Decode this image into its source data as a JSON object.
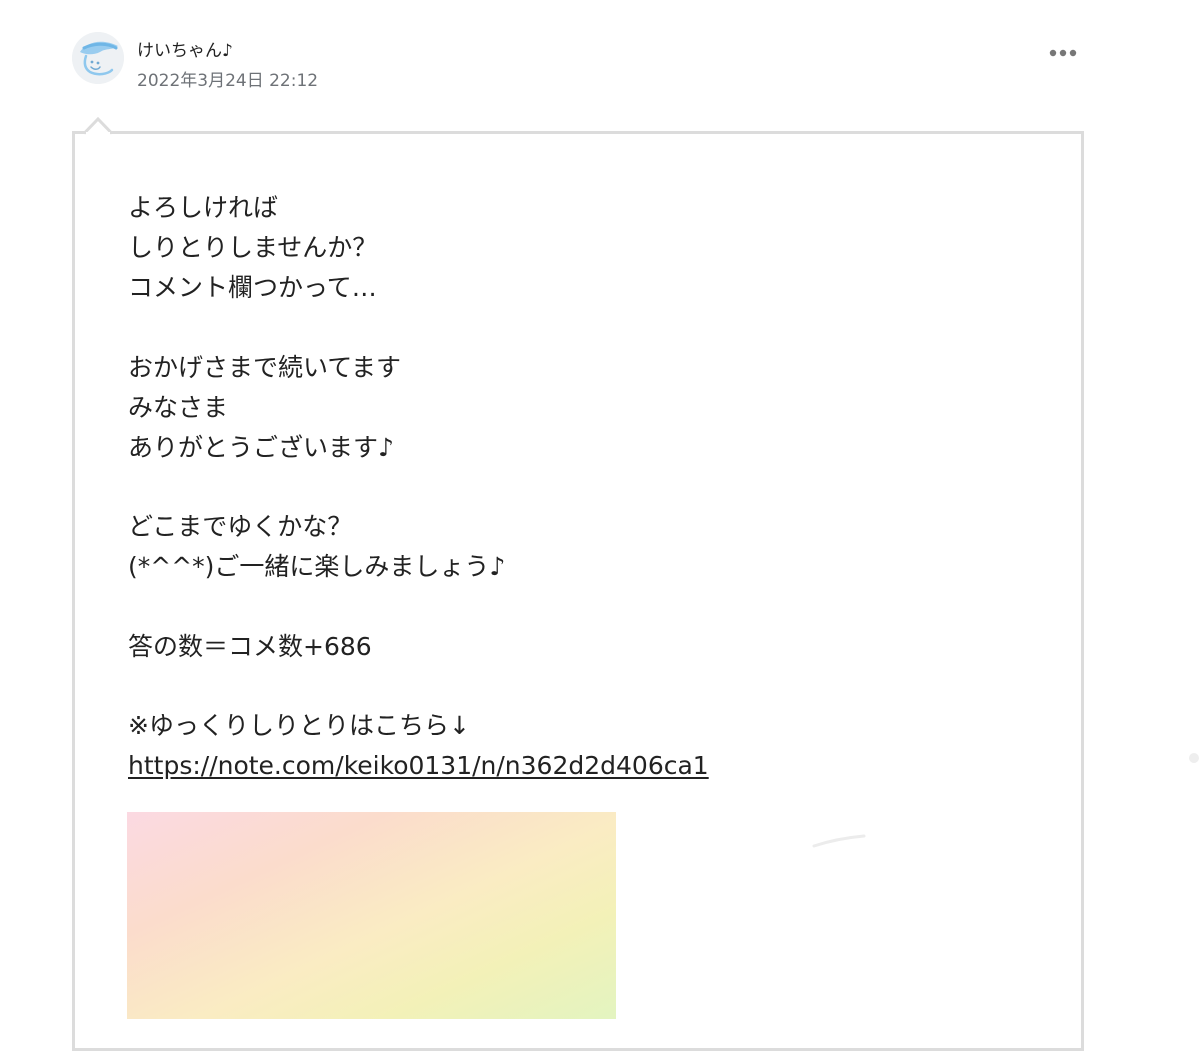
{
  "post": {
    "author": "けいちゃん♪",
    "date": "2022年3月24日 22:12",
    "avatar_icon": "avatar-icon",
    "more_icon": "more-horizontal-icon"
  },
  "comment": {
    "lines": [
      "よろしければ",
      "しりとりしませんか？",
      "コメント欄つかって…",
      "おかげさまで続いてます",
      "みなさま",
      "ありがとうございます♪",
      "どこまでゆくかな？",
      "(*^^*)ご一緒に楽しみましょう♪",
      "答の数＝コメ数+686",
      "※ゆっくりしりとりはこちら↓"
    ],
    "link_url": "https://note.com/keiko0131/n/n362d2d406ca1"
  },
  "colors": {
    "text": "#222222",
    "meta": "#6e7277",
    "border": "#dcdcdc",
    "icon": "#777777"
  }
}
